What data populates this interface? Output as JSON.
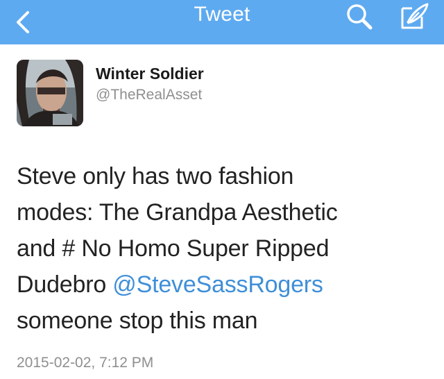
{
  "nav": {
    "title": "Tweet",
    "color": "#5eaaf0"
  },
  "author": {
    "display_name": "Winter Soldier",
    "handle": "@TheRealAsset"
  },
  "tweet": {
    "line1": "Steve only has two fashion",
    "line2": "modes: The Grandpa Aesthetic",
    "line3": "and # No Homo Super Ripped",
    "line4_text": "Dudebro ",
    "mention": "@SteveSassRogers",
    "line5": "someone stop this man",
    "mention_color": "#3f8fd8"
  },
  "timestamp": "2015-02-02, 7:12 PM",
  "icons": {
    "back": "chevron-left-icon",
    "search": "search-icon",
    "compose": "compose-icon"
  }
}
